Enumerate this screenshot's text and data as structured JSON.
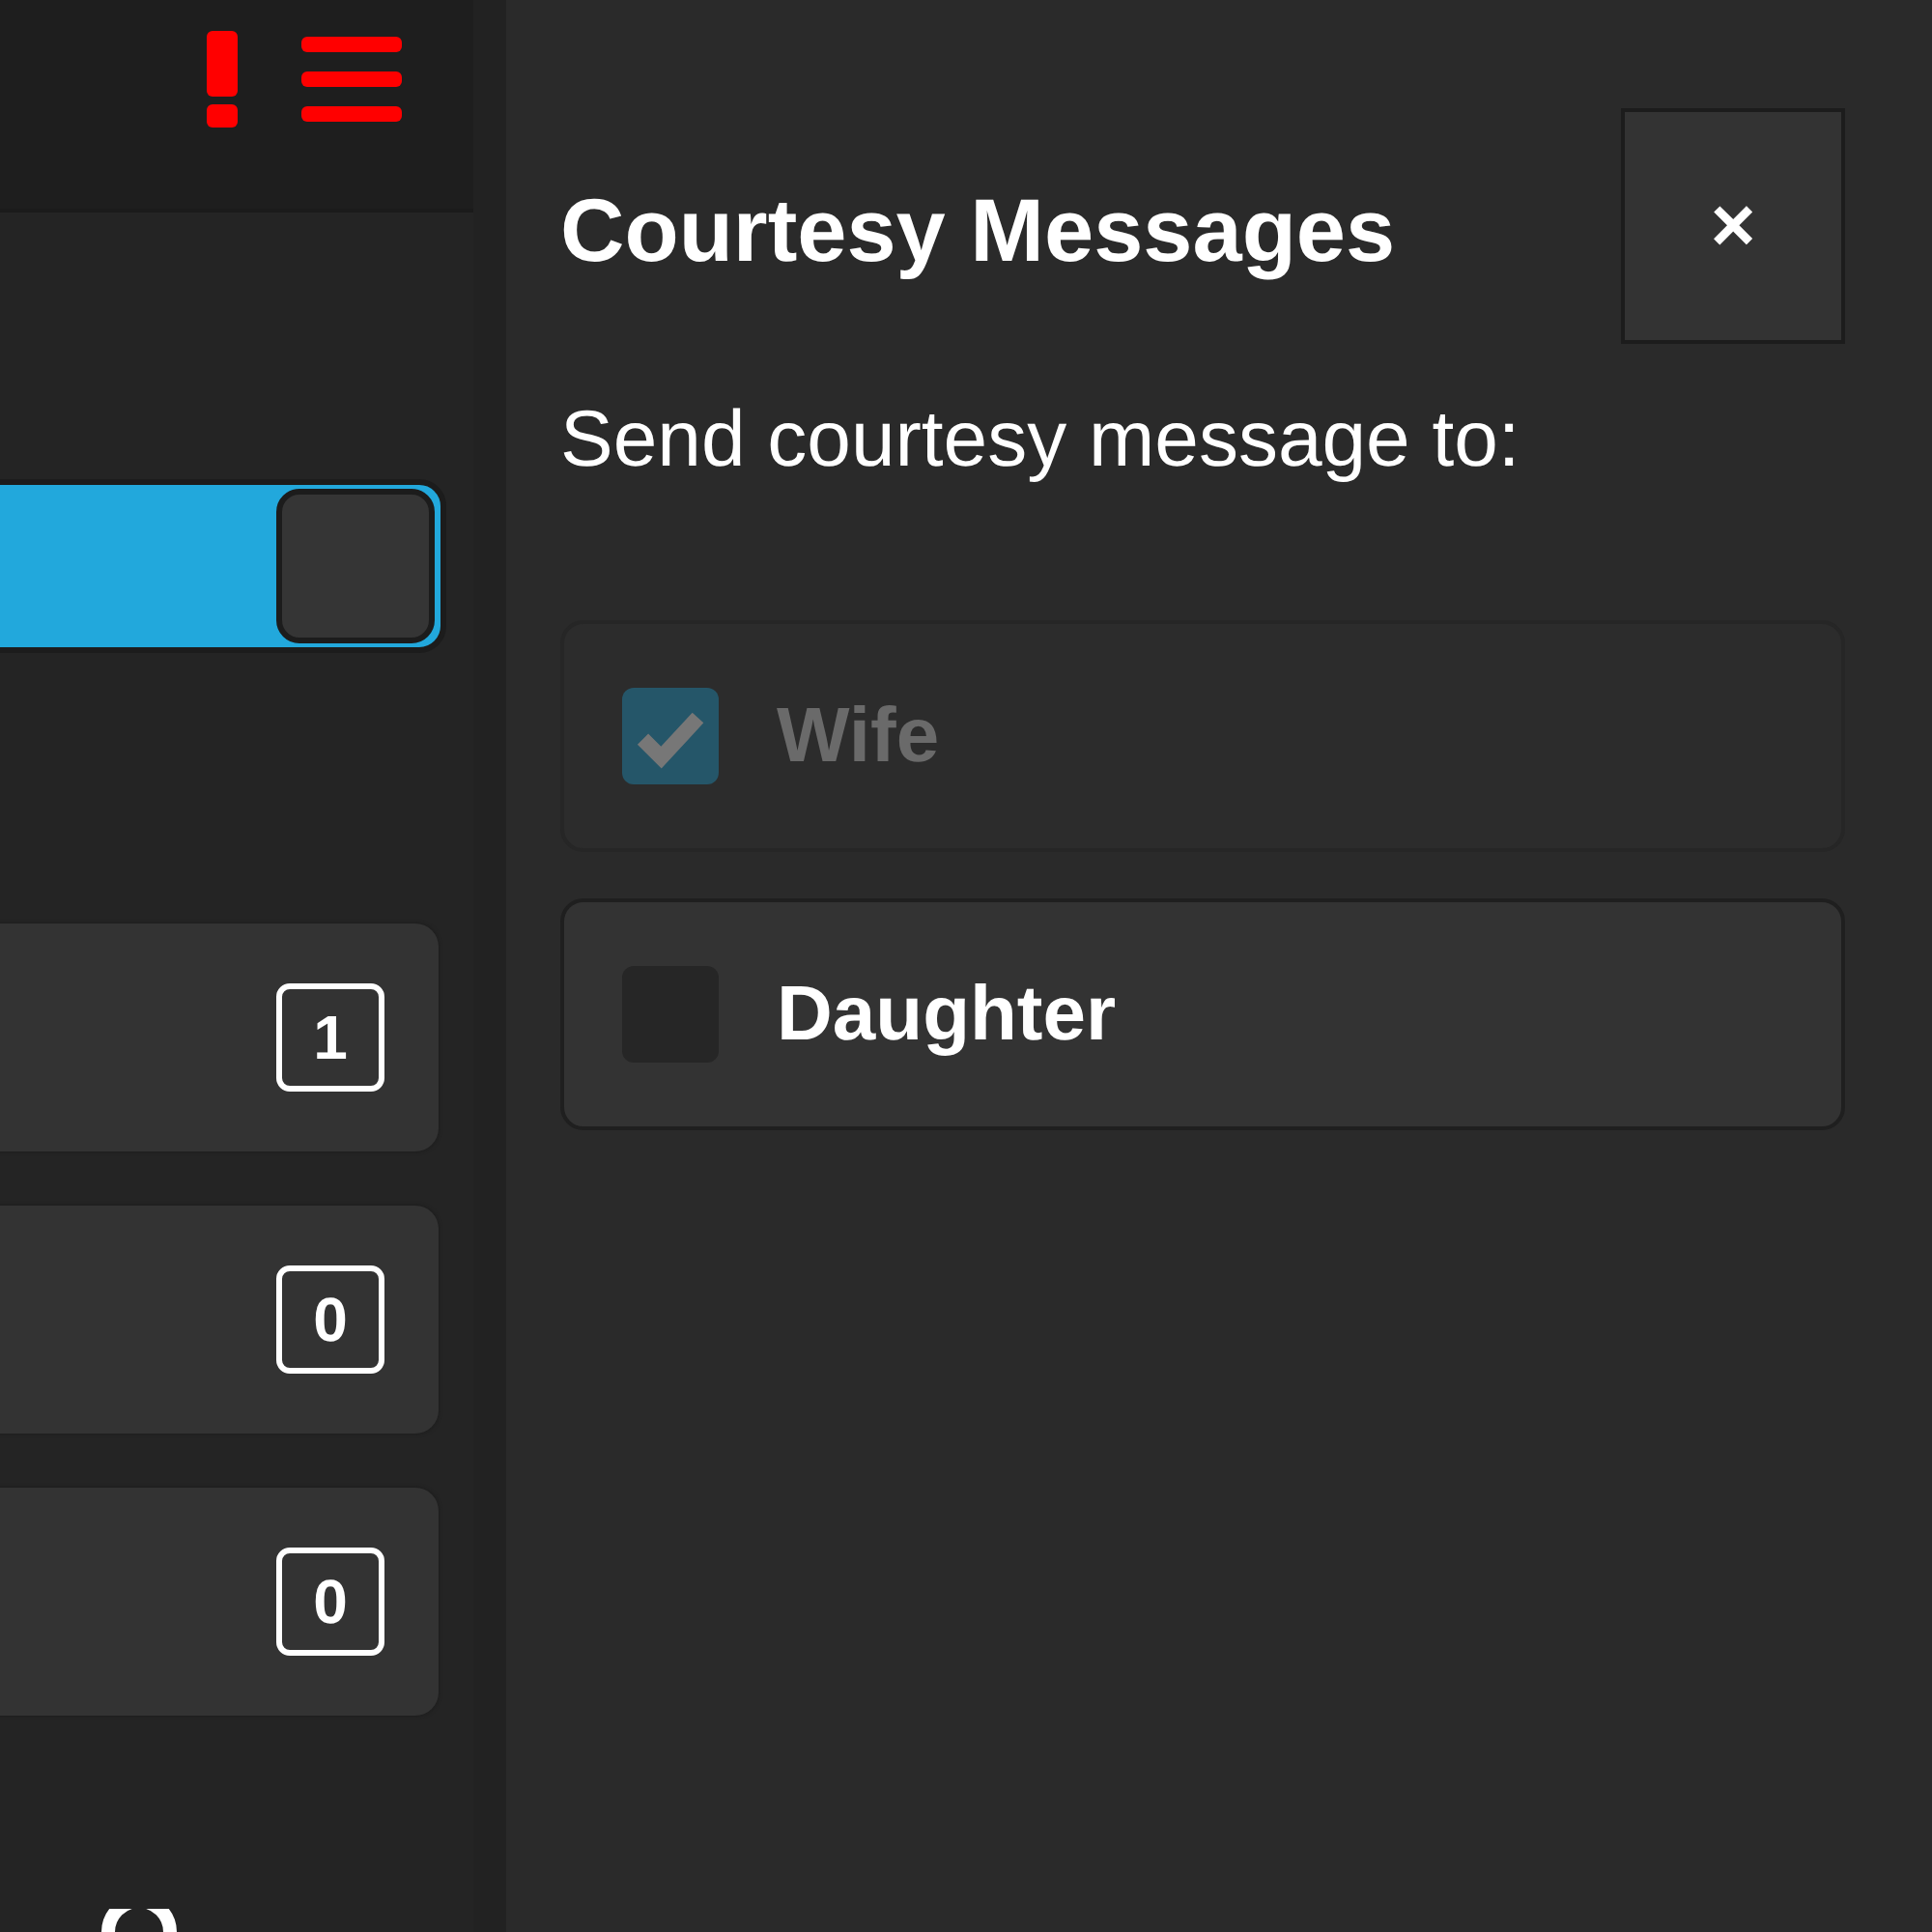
{
  "toggle": {
    "on": true
  },
  "counters": [
    {
      "value": "1"
    },
    {
      "value": "0"
    },
    {
      "value": "0"
    }
  ],
  "dialog": {
    "title": "Courtesy Messages",
    "close": "×",
    "prompt": "Send courtesy message to:",
    "options": [
      {
        "label": "Wife",
        "checked": true,
        "disabled": true
      },
      {
        "label": "Daughter",
        "checked": false,
        "disabled": false
      }
    ]
  }
}
